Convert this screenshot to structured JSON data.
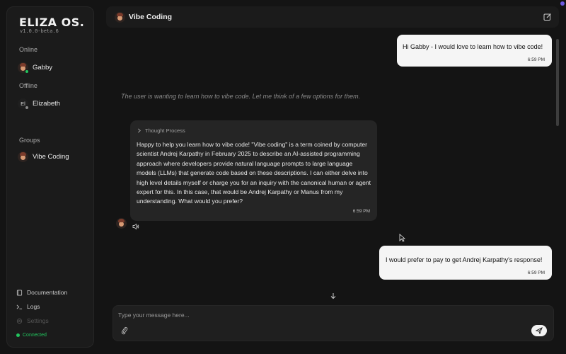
{
  "sidebar": {
    "logo": "ELIZA OS.",
    "version": "v1.0.0-beta.6",
    "online_label": "Online",
    "offline_label": "Offline",
    "groups_label": "Groups",
    "online_agents": [
      {
        "name": "Gabby",
        "status_color": "#22c55e"
      }
    ],
    "offline_agents": [
      {
        "name": "Elizabeth",
        "initials": "El",
        "status_color": "#8a8a8a"
      }
    ],
    "groups": [
      {
        "name": "Vibe Coding"
      }
    ],
    "footer": {
      "documentation": "Documentation",
      "logs": "Logs",
      "settings": "Settings",
      "connected": "Connected"
    }
  },
  "header": {
    "title": "Vibe Coding"
  },
  "chat": {
    "messages": [
      {
        "role": "user",
        "text": "Hi Gabby - I would love to learn how to vibe code!",
        "time": "6:59 PM"
      },
      {
        "role": "thought",
        "text": "The user is wanting to learn how to vibe code. Let me think of a few options for them."
      },
      {
        "role": "agent",
        "thought_label": "Thought Process",
        "text": "Happy to help you learn how to vibe code! \"Vibe coding\" is a term coined by computer scientist Andrej Karpathy in February 2025 to describe an AI-assisted programming approach where developers provide natural language prompts to large language models (LLMs) that generate code based on these descriptions. I can either delve into high level details myself or charge you for an inquiry with the canonical human or agent expert for this. In this case, that would be Andrej Karpathy or Manus from my understanding. What would you prefer?",
        "time": "6:59 PM"
      },
      {
        "role": "user",
        "text": "I would prefer to pay to get Andrej Karpathy's response!",
        "time": "6:59 PM"
      }
    ]
  },
  "input": {
    "placeholder": "Type your message here..."
  },
  "icons": [
    "chevron-right-icon",
    "speaker-icon",
    "arrow-down-icon",
    "paperclip-icon",
    "send-icon",
    "edit-icon",
    "book-icon",
    "terminal-icon",
    "gear-icon"
  ],
  "colors": {
    "accent": "#22c55e",
    "corner_dot": "#6d5ae0"
  }
}
